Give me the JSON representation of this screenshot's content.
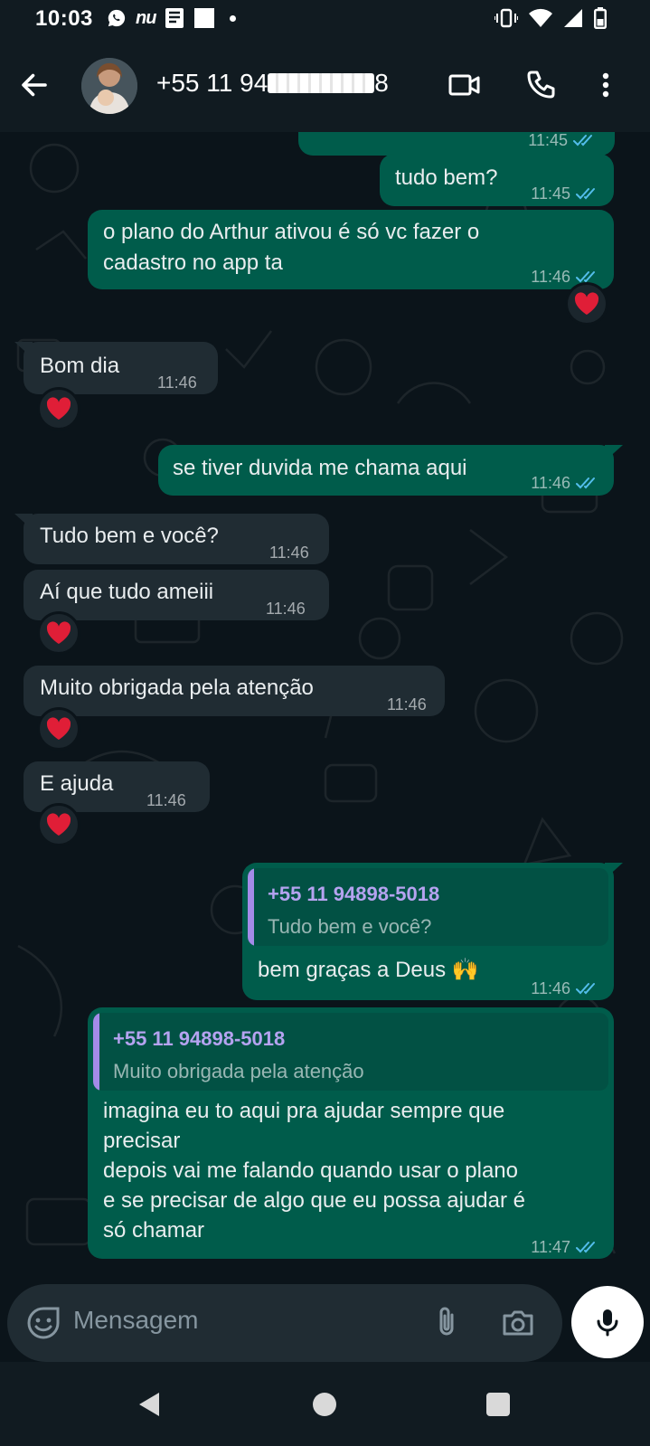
{
  "status_bar": {
    "time": "10:03",
    "apps": [
      "whatsapp-icon",
      "nubank-icon",
      "news-icon",
      "square-icon",
      "dot"
    ],
    "nu_label": "nu",
    "right_icons": [
      "vibrate-icon",
      "wifi-icon",
      "signal-icon",
      "battery-icon"
    ]
  },
  "header": {
    "contact_prefix": "+55 11 94",
    "contact_suffix": "8",
    "actions": [
      "video-call-icon",
      "voice-call-icon",
      "more-options-icon"
    ]
  },
  "messages": [
    {
      "id": "m0",
      "direction": "out",
      "text": "",
      "time": "11:45",
      "status": "read"
    },
    {
      "id": "m1",
      "direction": "out",
      "text": "tudo bem?",
      "time": "11:45",
      "status": "read"
    },
    {
      "id": "m2",
      "direction": "out",
      "lines": [
        "o plano do Arthur ativou é só vc fazer o",
        "cadastro no app ta"
      ],
      "time": "11:46",
      "status": "read",
      "reaction": "❤️"
    },
    {
      "id": "m3",
      "direction": "in",
      "text": "Bom dia",
      "time": "11:46",
      "reaction": "❤️"
    },
    {
      "id": "m4",
      "direction": "out",
      "text": "se tiver duvida me chama aqui",
      "time": "11:46",
      "status": "read"
    },
    {
      "id": "m5",
      "direction": "in",
      "text": "Tudo bem e você?",
      "time": "11:46"
    },
    {
      "id": "m6",
      "direction": "in",
      "text": "Aí que tudo ameiii",
      "time": "11:46",
      "reaction": "❤️"
    },
    {
      "id": "m7",
      "direction": "in",
      "text": "Muito obrigada pela atenção",
      "time": "11:46",
      "reaction": "❤️"
    },
    {
      "id": "m8",
      "direction": "in",
      "text": "E ajuda",
      "time": "11:46",
      "reaction": "❤️"
    },
    {
      "id": "m9",
      "direction": "out",
      "quote": {
        "name": "+55 11 94898-5018",
        "text": "Tudo bem e você?"
      },
      "text": "bem graças a Deus",
      "emoji": "🙌",
      "time": "11:46",
      "status": "read"
    },
    {
      "id": "m10",
      "direction": "out",
      "quote": {
        "name": "+55 11 94898-5018",
        "text": "Muito obrigada pela atenção"
      },
      "lines": [
        "imagina eu to aqui pra ajudar sempre que",
        "precisar",
        "depois vai me falando quando usar o plano",
        "e se precisar de algo que eu possa ajudar é",
        "só chamar"
      ],
      "time": "11:47",
      "status": "read"
    }
  ],
  "composer": {
    "placeholder": "Mensagem",
    "icons": [
      "emoji-icon",
      "attach-icon",
      "camera-icon",
      "microphone-icon"
    ]
  },
  "nav_bar": [
    "back-triangle-icon",
    "home-circle-icon",
    "recents-square-icon"
  ],
  "colors": {
    "background": "#0b141a",
    "header": "#111b21",
    "outgoing_bubble": "#005c4b",
    "incoming_bubble": "#202c33",
    "quote_bar": "#a48be8",
    "read_ticks": "#53bdeb",
    "reaction_heart": "#e01e37"
  }
}
